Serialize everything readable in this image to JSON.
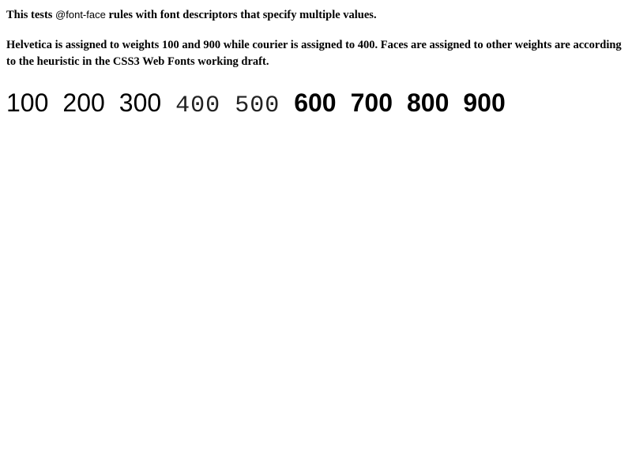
{
  "intro": {
    "prefix": "This tests ",
    "code": "@font-face",
    "suffix": " rules with font descriptors that specify multiple values."
  },
  "description": "Helvetica is assigned to weights 100 and 900 while courier is assigned to 400. Faces are assigned to other weights are according to the heuristic in the CSS3 Web Fonts working draft.",
  "weights": [
    "100",
    "200",
    "300",
    "400",
    "500",
    "600",
    "700",
    "800",
    "900"
  ]
}
